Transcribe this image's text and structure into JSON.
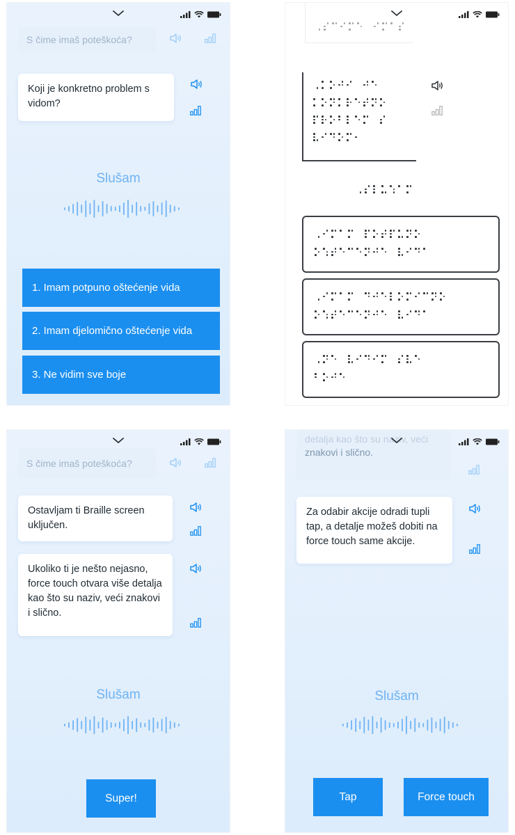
{
  "colors": {
    "accent": "#1b8ff0",
    "listening_text": "#6fb3f3",
    "screen_bg": "#e3effc"
  },
  "icons": {
    "speaker": "speaker-icon",
    "bars": "bars-icon",
    "chevron": "chevron-down-icon"
  },
  "screen1": {
    "prev_message": "S čime imaš poteškoća?",
    "message": "Koji je konkretno problem s vidom?",
    "listening": "Slušam",
    "options": [
      "1. Imam potpuno oštećenje vida",
      "2. Imam djelomično oštećenje vida",
      "3. Ne vidim sve boje"
    ]
  },
  "screen2": {
    "braille_header": "⠠⠎⠉⠊⠍⠑⠀⠊⠍⠁⠎",
    "braille_message": [
      "⠠⠅⠕⠚⠊⠀⠚⠑",
      "⠅⠕⠝⠅⠗⠑⠞⠝⠕",
      "⠏⠗⠕⠃⠇⠑⠍⠀⠎",
      "⠧⠊⠙⠕⠍⠂"
    ],
    "braille_listening": "⠠⠎⠇⠥⠱⠁⠍",
    "braille_options": [
      [
        "⠠⠊⠍⠁⠍⠀⠏⠕⠞⠏⠥⠝⠕",
        "⠕⠱⠞⠑⠉⠑⠝⠚⠑⠀⠧⠊⠙⠁"
      ],
      [
        "⠠⠊⠍⠁⠍⠀⠙⠚⠑⠇⠕⠍⠊⠉⠝⠕",
        "⠕⠱⠞⠑⠉⠑⠝⠚⠑⠀⠧⠊⠙⠁"
      ],
      [
        "⠠⠝⠑⠀⠧⠊⠙⠊⠍⠀⠎⠧⠑",
        "⠃⠕⠚⠑"
      ]
    ]
  },
  "screen3": {
    "prev_message": "S čime imaš poteškoća?",
    "messages": [
      "Ostavljam ti Braille screen uključen.",
      "Ukoliko ti je nešto nejasno, force touch otvara više detalja kao što su naziv, veći znakovi i slično."
    ],
    "listening": "Slušam",
    "button": "Super!"
  },
  "screen4": {
    "prev_message_line1": "detalja kao što su naziv, veći",
    "prev_message_line2": "znakovi i slično.",
    "message": "Za odabir akcije odradi tupli tap, a detalje možeš dobiti na force touch same akcije.",
    "listening": "Slušam",
    "buttons": [
      "Tap",
      "Force touch"
    ]
  }
}
